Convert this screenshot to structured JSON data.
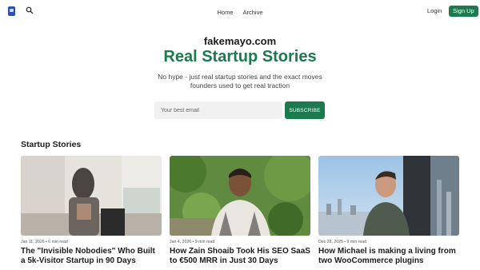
{
  "nav": {
    "links": [
      "Home",
      "Archive"
    ],
    "login_label": "Login",
    "signup_label": "Sign Up"
  },
  "hero": {
    "site_name": "fakemayo.com",
    "headline": "Real Startup Stories",
    "subline_1": "No hype - just real startup stories and the exact moves",
    "subline_2": "founders used to get real traction",
    "email_placeholder": "Your best email",
    "subscribe_label": "SUBSCRIBE"
  },
  "stories": {
    "section_title": "Startup Stories",
    "cards": [
      {
        "meta": "Jan 11, 2026 • 6 min read",
        "title": "The \"Invisible Nobodies\" Who Built a 5k-Visitor Startup in 90 Days"
      },
      {
        "meta": "Jan 4, 2026 • 9 min read",
        "title": "How Zain Shoaib Took His SEO SaaS to €500 MRR in Just 30 Days"
      },
      {
        "meta": "Dec 28, 2025 • 9 min read",
        "title": "How Michael is making a living from two WooCommerce plugins"
      }
    ]
  },
  "colors": {
    "brand_green": "#1b7a4e",
    "logo_blue": "#2f4fb8"
  },
  "icons": [
    "logo-icon",
    "search-icon"
  ]
}
